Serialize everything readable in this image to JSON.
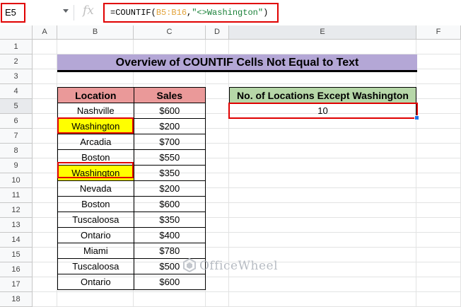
{
  "formula_bar": {
    "cell_ref": "E5",
    "fx_label": "fx",
    "formula_prefix": "=COUNTIF(",
    "formula_range": "B5:B16",
    "formula_comma": ",",
    "formula_string": "\"<>Washington\"",
    "formula_suffix": ")"
  },
  "columns": [
    "A",
    "B",
    "C",
    "D",
    "E",
    "F"
  ],
  "rows": [
    "1",
    "2",
    "3",
    "4",
    "5",
    "6",
    "7",
    "8",
    "9",
    "10",
    "11",
    "12",
    "13",
    "14",
    "15",
    "16",
    "17",
    "18"
  ],
  "title": "Overview of COUNTIF Cells Not Equal to Text",
  "table": {
    "headers": [
      "Location",
      "Sales"
    ],
    "rows": [
      {
        "location": "Nashville",
        "sales": "$600"
      },
      {
        "location": "Washington",
        "sales": "$200"
      },
      {
        "location": "Arcadia",
        "sales": "$700"
      },
      {
        "location": "Boston",
        "sales": "$550"
      },
      {
        "location": "Washington",
        "sales": "$350"
      },
      {
        "location": "Nevada",
        "sales": "$200"
      },
      {
        "location": "Boston",
        "sales": "$600"
      },
      {
        "location": "Tuscaloosa",
        "sales": "$350"
      },
      {
        "location": "Ontario",
        "sales": "$400"
      },
      {
        "location": "Miami",
        "sales": "$780"
      },
      {
        "location": "Tuscaloosa",
        "sales": "$500"
      },
      {
        "location": "Ontario",
        "sales": "$600"
      }
    ]
  },
  "result": {
    "header": "No. of Locations Except Washington",
    "value": "10"
  },
  "watermark": "OfficeWheel",
  "colors": {
    "title_bg": "#b4a7d6",
    "header_bg": "#ea9999",
    "result_header_bg": "#b6d7a8",
    "highlight": "#ffff00",
    "annotation": "#e00000"
  }
}
